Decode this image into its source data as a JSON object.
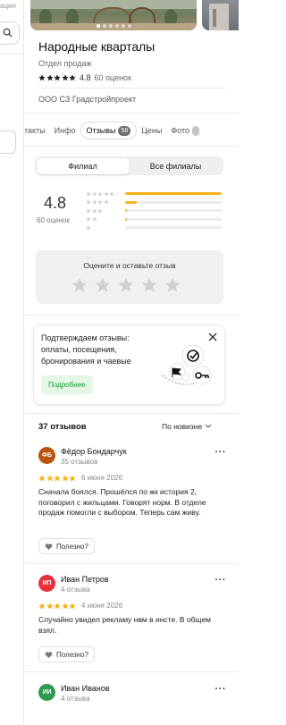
{
  "left_strip": {
    "clip_text": "ация"
  },
  "place": {
    "name": "Народные кварталы",
    "category": "Отдел продаж",
    "rating": "4.8",
    "rating_count": "60 оценок",
    "organization": "ООО СЗ Градстройпроект"
  },
  "photo_dots": {
    "count": 6,
    "active": 0
  },
  "tabs": [
    {
      "label": "нтакты"
    },
    {
      "label": "Инфо"
    },
    {
      "label": "Отзывы",
      "badge": "58",
      "active": true
    },
    {
      "label": "Цены"
    },
    {
      "label": "Фото"
    }
  ],
  "segment": {
    "branch": "Филиал",
    "all_branches": "Все филиалы",
    "selected": "branch"
  },
  "summary": {
    "rating": "4.8",
    "count": "60 оценок",
    "distribution": [
      {
        "stars": 5,
        "fraction": 1.0
      },
      {
        "stars": 4,
        "fraction": 0.12
      },
      {
        "stars": 3,
        "fraction": 0.02
      },
      {
        "stars": 2,
        "fraction": 0.02
      },
      {
        "stars": 1,
        "fraction": 0.0
      }
    ]
  },
  "rate_prompt": {
    "label": "Оцените и оставьте отзыв",
    "stars": 5
  },
  "promo": {
    "text": "Подтверждаем отзывы: оплаты, посещения, бронирования и чаевые",
    "button": "Подробнее"
  },
  "reviews_header": {
    "count": "37 отзывов",
    "sort": "По новизне"
  },
  "reviews": [
    {
      "initials": "ФБ",
      "avatar_color": "#b8540f",
      "name": "Фёдор Бондарчук",
      "sub": "35 отзывов",
      "stars": 5,
      "date": "6 июня 2026",
      "text": "Сначала боялся. Прошёлся по жк история 2, поговорил с жильцами. Говорят норм. В отделе продаж помогли с выбором. Теперь сам живу.",
      "useful": "Полезно?"
    },
    {
      "initials": "ИП",
      "avatar_color": "#e5313d",
      "name": "Иван Петров",
      "sub": "4 отзыва",
      "stars": 5,
      "date": "4 июня 2026",
      "text": "Случайно увидел рекламу нвм в инсте. В общем взял.",
      "useful": "Полезно?"
    },
    {
      "initials": "ИИ",
      "avatar_color": "#2f9a4e",
      "name": "Иван Иванов",
      "sub": "4 отзыва"
    }
  ],
  "colors": {
    "star": "#f6b31b",
    "star_empty": "#d0d0d0",
    "accent_green": "#169b3a"
  }
}
